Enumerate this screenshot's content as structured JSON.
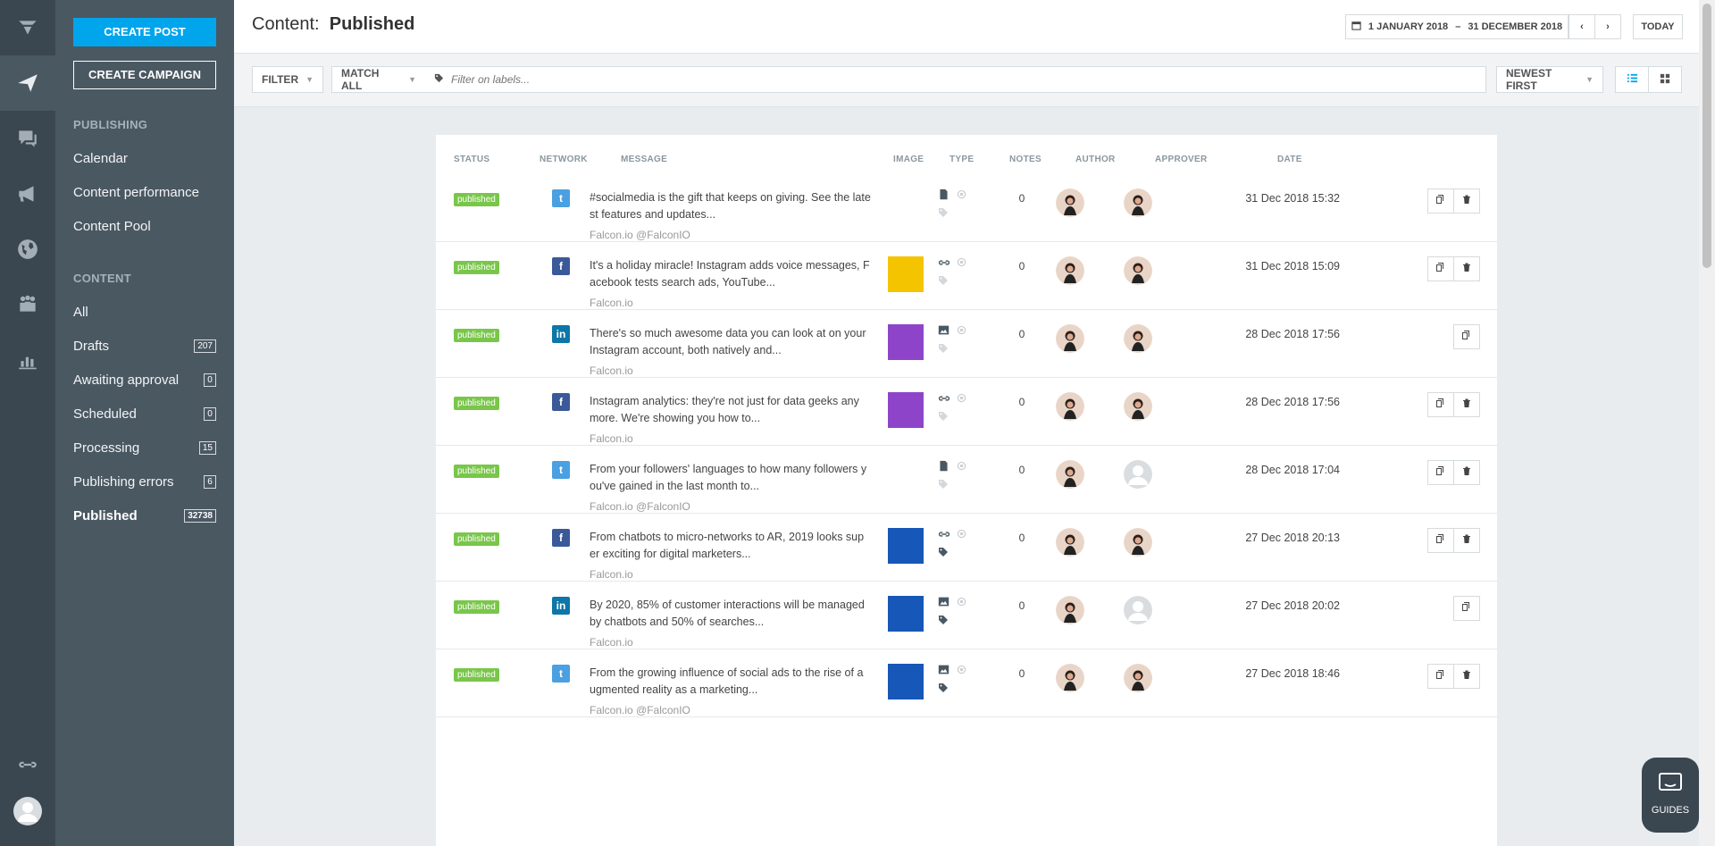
{
  "rail": {
    "items": [
      "logo-icon",
      "send-icon",
      "chat-icon",
      "megaphone-icon",
      "globe-icon",
      "people-icon",
      "bar-chart-icon",
      "link-icon",
      "user-avatar-icon"
    ]
  },
  "sidebar": {
    "create_post": "CREATE POST",
    "create_campaign": "CREATE CAMPAIGN",
    "publishing_heading": "PUBLISHING",
    "publishing_links": [
      "Calendar",
      "Content performance",
      "Content Pool"
    ],
    "content_heading": "CONTENT",
    "content_links": [
      {
        "label": "All",
        "count": ""
      },
      {
        "label": "Drafts",
        "count": "207"
      },
      {
        "label": "Awaiting approval",
        "count": "0"
      },
      {
        "label": "Scheduled",
        "count": "0"
      },
      {
        "label": "Processing",
        "count": "15"
      },
      {
        "label": "Publishing errors",
        "count": "6"
      },
      {
        "label": "Published",
        "count": "32738"
      }
    ]
  },
  "header": {
    "title_prefix": "Content:",
    "title_value": "Published",
    "date_start": "1 JANUARY 2018",
    "date_sep": "–",
    "date_end": "31 DECEMBER 2018",
    "prev_icon": "chevron-left-icon",
    "next_icon": "chevron-right-icon",
    "today_label": "TODAY"
  },
  "filterbar": {
    "filter_label": "FILTER",
    "match_label": "MATCH ALL",
    "labels_placeholder": "Filter on labels...",
    "sort_label": "NEWEST FIRST",
    "view_list_icon": "list-view-icon",
    "view_grid_icon": "grid-view-icon"
  },
  "table": {
    "headers": {
      "status": "STATUS",
      "network": "NETWORK",
      "message": "MESSAGE",
      "image": "IMAGE",
      "type": "TYPE",
      "notes": "NOTES",
      "author": "AUTHOR",
      "approver": "APPROVER",
      "date": "DATE"
    },
    "rows": [
      {
        "status": "published",
        "network": "twitter",
        "network_glyph": "t",
        "message": "#socialmedia is the gift that keeps on giving. See the late st features and updates...",
        "source": "Falcon.io @FalconIO",
        "image": "none",
        "type_icon": "document-icon",
        "notes": "0",
        "approver_has_photo": true,
        "date": "31 Dec 2018 15:32",
        "can_delete": true
      },
      {
        "status": "published",
        "network": "facebook",
        "network_glyph": "f",
        "message": "It's a holiday miracle! Instagram adds voice messages, F acebook tests search ads, YouTube...",
        "source": "Falcon.io",
        "image": "yellow",
        "type_icon": "link-icon",
        "notes": "0",
        "approver_has_photo": true,
        "date": "31 Dec 2018 15:09",
        "can_delete": true
      },
      {
        "status": "published",
        "network": "linkedin",
        "network_glyph": "in",
        "message": "There's so much awesome data you can look at on your Instagram account, both natively and...",
        "source": "Falcon.io",
        "image": "purple",
        "type_icon": "image-icon",
        "notes": "0",
        "approver_has_photo": true,
        "date": "28 Dec 2018 17:56",
        "can_delete": false
      },
      {
        "status": "published",
        "network": "facebook",
        "network_glyph": "f",
        "message": "Instagram analytics: they're not just for data geeks any more. We're showing you how to...",
        "source": "Falcon.io",
        "image": "purple",
        "type_icon": "link-icon",
        "notes": "0",
        "approver_has_photo": true,
        "date": "28 Dec 2018 17:56",
        "can_delete": true
      },
      {
        "status": "published",
        "network": "twitter",
        "network_glyph": "t",
        "message": "From your followers' languages to how many followers y ou've gained in the last month to...",
        "source": "Falcon.io @FalconIO",
        "image": "none",
        "type_icon": "document-icon",
        "notes": "0",
        "approver_has_photo": false,
        "date": "28 Dec 2018 17:04",
        "can_delete": true
      },
      {
        "status": "published",
        "network": "facebook",
        "network_glyph": "f",
        "message": "From chatbots to micro-networks to AR, 2019 looks sup er exciting for digital marketers...",
        "source": "Falcon.io",
        "image": "blue",
        "type_icon": "link-icon",
        "notes": "0",
        "approver_has_photo": true,
        "date": "27 Dec 2018 20:13",
        "can_delete": true
      },
      {
        "status": "published",
        "network": "linkedin",
        "network_glyph": "in",
        "message": "By 2020, 85% of customer interactions will be managed by chatbots and 50% of searches...",
        "source": "Falcon.io",
        "image": "blue",
        "type_icon": "image-icon",
        "notes": "0",
        "approver_has_photo": false,
        "date": "27 Dec 2018 20:02",
        "can_delete": false
      },
      {
        "status": "published",
        "network": "twitter",
        "network_glyph": "t",
        "message": "From the growing influence of social ads to the rise of a ugmented reality as a marketing...",
        "source": "Falcon.io @FalconIO",
        "image": "blue",
        "type_icon": "image-icon",
        "notes": "0",
        "approver_has_photo": true,
        "date": "27 Dec 2018 18:46",
        "can_delete": true
      }
    ]
  },
  "guides": {
    "label": "GUIDES"
  },
  "colors": {
    "accent": "#00a5ec",
    "published": "#79c64a",
    "twitter": "#4aa0e0",
    "facebook": "#3b5998",
    "linkedin": "#0e76a8",
    "thumb_yellow": "#f5c400",
    "thumb_purple": "#8e44c9",
    "thumb_blue": "#1657b8"
  }
}
